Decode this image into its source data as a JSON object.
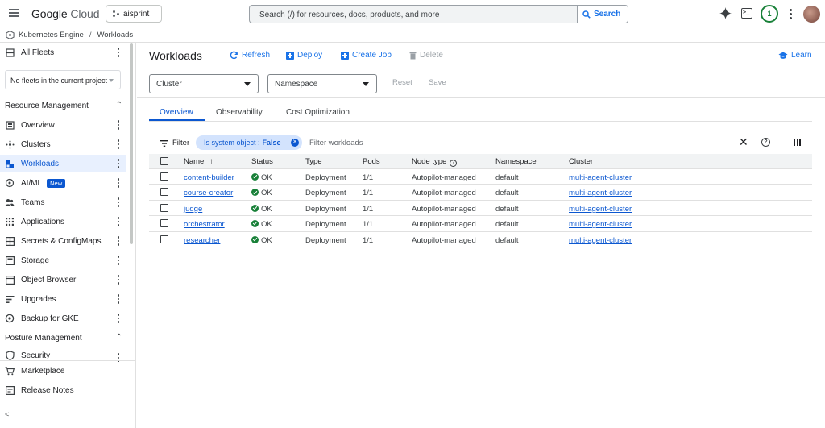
{
  "header": {
    "logo_google": "Google",
    "logo_cloud": "Cloud",
    "project": "aisprint",
    "search_placeholder": "Search (/) for resources, docs, products, and more",
    "search_button": "Search",
    "notification_count": "1"
  },
  "breadcrumb": {
    "parent": "Kubernetes Engine",
    "separator": "/",
    "current": "Workloads"
  },
  "sidebar": {
    "all_fleets": "All Fleets",
    "fleet_select": "No fleets in the current project",
    "resource_management": "Resource Management",
    "items": [
      {
        "label": "Overview"
      },
      {
        "label": "Clusters"
      },
      {
        "label": "Workloads"
      },
      {
        "label": "AI/ML",
        "badge": "New"
      },
      {
        "label": "Teams"
      },
      {
        "label": "Applications"
      },
      {
        "label": "Secrets & ConfigMaps"
      },
      {
        "label": "Storage"
      },
      {
        "label": "Object Browser"
      },
      {
        "label": "Upgrades"
      },
      {
        "label": "Backup for GKE"
      }
    ],
    "posture_management": "Posture Management",
    "security": "Security",
    "marketplace": "Marketplace",
    "release_notes": "Release Notes",
    "collapse": "<|"
  },
  "page": {
    "title": "Workloads",
    "actions": {
      "refresh": "Refresh",
      "deploy": "Deploy",
      "create_job": "Create Job",
      "delete": "Delete",
      "learn": "Learn"
    },
    "cluster_select": "Cluster",
    "namespace_select": "Namespace",
    "reset": "Reset",
    "save": "Save",
    "tabs": [
      "Overview",
      "Observability",
      "Cost Optimization"
    ],
    "active_tab": "Overview"
  },
  "filter": {
    "label": "Filter",
    "chip_key": "Is system object :",
    "chip_value": "False",
    "placeholder": "Filter workloads"
  },
  "table": {
    "columns": [
      "Name",
      "Status",
      "Type",
      "Pods",
      "Node type",
      "Namespace",
      "Cluster"
    ],
    "rows": [
      {
        "name": "content-builder",
        "status": "OK",
        "type": "Deployment",
        "pods": "1/1",
        "node_type": "Autopilot-managed",
        "namespace": "default",
        "cluster": "multi-agent-cluster"
      },
      {
        "name": "course-creator",
        "status": "OK",
        "type": "Deployment",
        "pods": "1/1",
        "node_type": "Autopilot-managed",
        "namespace": "default",
        "cluster": "multi-agent-cluster"
      },
      {
        "name": "judge",
        "status": "OK",
        "type": "Deployment",
        "pods": "1/1",
        "node_type": "Autopilot-managed",
        "namespace": "default",
        "cluster": "multi-agent-cluster"
      },
      {
        "name": "orchestrator",
        "status": "OK",
        "type": "Deployment",
        "pods": "1/1",
        "node_type": "Autopilot-managed",
        "namespace": "default",
        "cluster": "multi-agent-cluster"
      },
      {
        "name": "researcher",
        "status": "OK",
        "type": "Deployment",
        "pods": "1/1",
        "node_type": "Autopilot-managed",
        "namespace": "default",
        "cluster": "multi-agent-cluster"
      }
    ]
  },
  "colors": {
    "accent": "#1a73e8",
    "active_nav_bg": "#e8f0fe",
    "status_ok": "#188038"
  }
}
